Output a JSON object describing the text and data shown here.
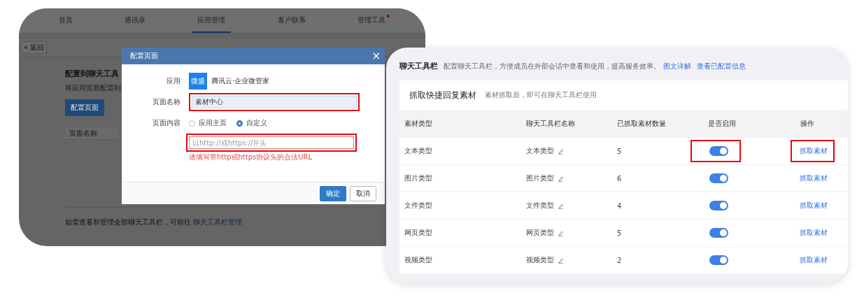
{
  "admin": {
    "tabs": [
      {
        "label": "首页",
        "selected": false,
        "dot": false
      },
      {
        "label": "通讯录",
        "selected": false,
        "dot": false
      },
      {
        "label": "应用管理",
        "selected": true,
        "dot": false
      },
      {
        "label": "客户联系",
        "selected": false,
        "dot": false
      },
      {
        "label": "管理工具",
        "selected": false,
        "dot": true
      }
    ],
    "back": "返回",
    "back_icon": "«",
    "heading": "配置到聊天工具",
    "subtitle": "将应用页面配置到",
    "action": "配置页面",
    "columns": [
      "页面名称"
    ],
    "footer": {
      "text": "如需查看和管理全部聊天工具栏，可前往 ",
      "link": "聊天工具栏管理"
    }
  },
  "dialog": {
    "title": "配置页面",
    "close": "×",
    "app": {
      "label": "应用",
      "logo": "微盛",
      "name": "腾讯云·企业微管家"
    },
    "name_field": {
      "label": "页面名称",
      "value": "素材中心",
      "highlighted": true
    },
    "content": {
      "label": "页面内容",
      "options": [
        {
          "label": "应用主页",
          "selected": false
        },
        {
          "label": "自定义",
          "selected": true
        }
      ]
    },
    "url_field": {
      "placeholder": "以http://或https://开头",
      "error": "请填写带http或https协议头的合法URL",
      "highlighted": true
    },
    "buttons": [
      {
        "label": "确定",
        "kind": "primary"
      },
      {
        "label": "取消",
        "kind": "default"
      }
    ]
  },
  "toolbar": {
    "title": "聊天工具栏",
    "description": "配置聊天工具栏，方便成员在外部会话中查看和使用，提高服务效率。",
    "links": [
      "图文详解",
      "查看已配置信息"
    ],
    "section": {
      "title": "抓取快捷回复素材",
      "hint": "素材抓取后，即可在聊天工具栏使用"
    },
    "columns": [
      "素材类型",
      "聊天工具栏名称",
      "已抓取素材数量",
      "是否启用",
      "操作"
    ],
    "rows": [
      {
        "type": "文本类型",
        "name": "文本类型",
        "count": "5",
        "on": true,
        "action": "抓取素材",
        "highlighted": true
      },
      {
        "type": "图片类型",
        "name": "图片类型",
        "count": "6",
        "on": true,
        "action": "抓取素材",
        "highlighted": false
      },
      {
        "type": "文件类型",
        "name": "文件类型",
        "count": "4",
        "on": true,
        "action": "抓取素材",
        "highlighted": false
      },
      {
        "type": "网页类型",
        "name": "网页类型",
        "count": "5",
        "on": true,
        "action": "抓取素材",
        "highlighted": false
      },
      {
        "type": "视频类型",
        "name": "视频类型",
        "count": "2",
        "on": true,
        "action": "抓取素材",
        "highlighted": false
      }
    ]
  }
}
